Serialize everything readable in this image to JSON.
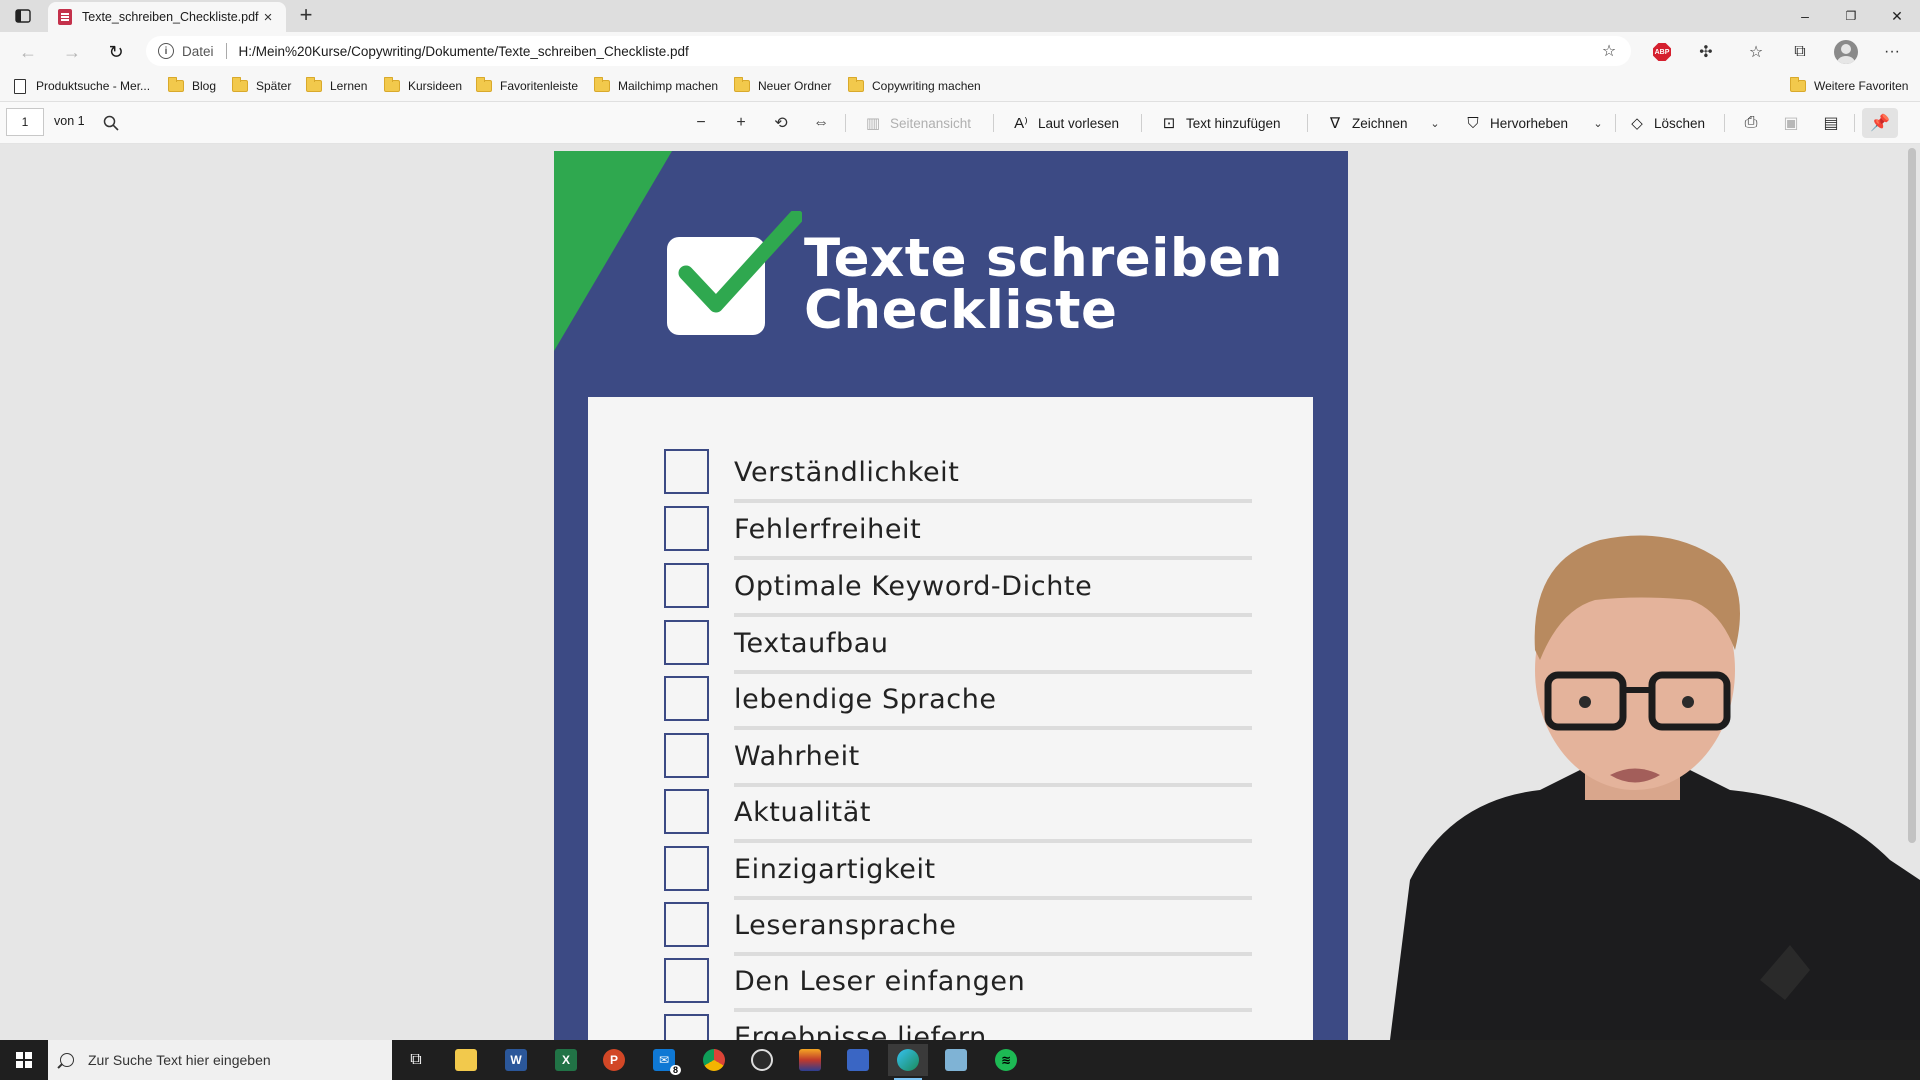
{
  "browser": {
    "tab": {
      "title": "Texte_schreiben_Checkliste.pdf",
      "close_glyph": "×"
    },
    "new_tab_glyph": "+",
    "window_controls": {
      "minimize": "–",
      "restore": "❐",
      "close": "✕"
    },
    "address": {
      "scheme_label": "Datei",
      "url": "H:/Mein%20Kurse/Copywriting/Dokumente/Texte_schreiben_Checkliste.pdf"
    },
    "abp_label": "ABP",
    "favorites": [
      {
        "label": "Produktsuche - Mer...",
        "icon": "page-icon"
      },
      {
        "label": "Blog",
        "icon": "folder-icon"
      },
      {
        "label": "Später",
        "icon": "folder-icon"
      },
      {
        "label": "Lernen",
        "icon": "folder-icon"
      },
      {
        "label": "Kursideen",
        "icon": "folder-icon"
      },
      {
        "label": "Favoritenleiste",
        "icon": "folder-icon"
      },
      {
        "label": "Mailchimp machen",
        "icon": "folder-icon"
      },
      {
        "label": "Neuer Ordner",
        "icon": "folder-icon"
      },
      {
        "label": "Copywriting machen",
        "icon": "folder-icon"
      }
    ],
    "other_favorites": "Weitere Favoriten"
  },
  "pdf_toolbar": {
    "page_number": "1",
    "page_total": "von 1",
    "page_view": "Seitenansicht",
    "read_aloud": "Laut vorlesen",
    "add_text": "Text hinzufügen",
    "draw": "Zeichnen",
    "highlight": "Hervorheben",
    "erase": "Löschen"
  },
  "document": {
    "title_line1": "Texte schreiben",
    "title_line2": "Checkliste",
    "colors": {
      "page_bg": "#3c4a84",
      "accent_green": "#2fa84f",
      "card_bg": "#f5f5f5"
    },
    "items": [
      "Verständlichkeit",
      "Fehlerfreiheit",
      "Optimale Keyword-Dichte",
      "Textaufbau",
      "lebendige Sprache",
      "Wahrheit",
      "Aktualität",
      "Einzigartigkeit",
      "Leseransprache",
      "Den Leser einfangen",
      "Ergebnisse liefern"
    ]
  },
  "taskbar": {
    "search_placeholder": "Zur Suche Text hier eingeben",
    "mail_badge": "8",
    "apps": [
      "task-view",
      "file-explorer",
      "word",
      "excel",
      "powerpoint",
      "mail",
      "chrome",
      "obs",
      "app",
      "app",
      "edge",
      "notepad",
      "spotify"
    ]
  }
}
